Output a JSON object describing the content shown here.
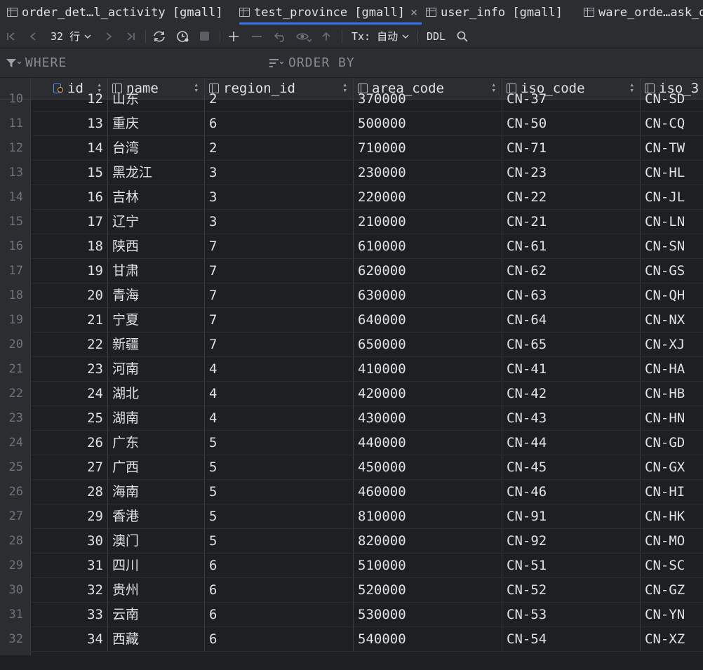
{
  "tabs": [
    {
      "label": "order_det…l_activity [gmall]",
      "active": false
    },
    {
      "label": "test_province [gmall]",
      "active": true
    },
    {
      "label": "user_info [gmall]",
      "active": false
    },
    {
      "label": "ware_orde…ask_d",
      "active": false
    }
  ],
  "toolbar": {
    "row_count_label": "32 行",
    "tx_label": "Tx: 自动",
    "ddl_label": "DDL"
  },
  "filter": {
    "where_label": "WHERE",
    "order_by_label": "ORDER BY"
  },
  "columns": [
    "id",
    "name",
    "region_id",
    "area_code",
    "iso_code",
    "iso_3"
  ],
  "rows": [
    {
      "n": "10",
      "id": "12",
      "name": "山东",
      "region_id": "2",
      "area_code": "370000",
      "iso_code": "CN-37",
      "iso_3": "CN-SD"
    },
    {
      "n": "11",
      "id": "13",
      "name": "重庆",
      "region_id": "6",
      "area_code": "500000",
      "iso_code": "CN-50",
      "iso_3": "CN-CQ"
    },
    {
      "n": "12",
      "id": "14",
      "name": "台湾",
      "region_id": "2",
      "area_code": "710000",
      "iso_code": "CN-71",
      "iso_3": "CN-TW"
    },
    {
      "n": "13",
      "id": "15",
      "name": "黑龙江",
      "region_id": "3",
      "area_code": "230000",
      "iso_code": "CN-23",
      "iso_3": "CN-HL"
    },
    {
      "n": "14",
      "id": "16",
      "name": "吉林",
      "region_id": "3",
      "area_code": "220000",
      "iso_code": "CN-22",
      "iso_3": "CN-JL"
    },
    {
      "n": "15",
      "id": "17",
      "name": "辽宁",
      "region_id": "3",
      "area_code": "210000",
      "iso_code": "CN-21",
      "iso_3": "CN-LN"
    },
    {
      "n": "16",
      "id": "18",
      "name": "陕西",
      "region_id": "7",
      "area_code": "610000",
      "iso_code": "CN-61",
      "iso_3": "CN-SN"
    },
    {
      "n": "17",
      "id": "19",
      "name": "甘肃",
      "region_id": "7",
      "area_code": "620000",
      "iso_code": "CN-62",
      "iso_3": "CN-GS"
    },
    {
      "n": "18",
      "id": "20",
      "name": "青海",
      "region_id": "7",
      "area_code": "630000",
      "iso_code": "CN-63",
      "iso_3": "CN-QH"
    },
    {
      "n": "19",
      "id": "21",
      "name": "宁夏",
      "region_id": "7",
      "area_code": "640000",
      "iso_code": "CN-64",
      "iso_3": "CN-NX"
    },
    {
      "n": "20",
      "id": "22",
      "name": "新疆",
      "region_id": "7",
      "area_code": "650000",
      "iso_code": "CN-65",
      "iso_3": "CN-XJ"
    },
    {
      "n": "21",
      "id": "23",
      "name": "河南",
      "region_id": "4",
      "area_code": "410000",
      "iso_code": "CN-41",
      "iso_3": "CN-HA"
    },
    {
      "n": "22",
      "id": "24",
      "name": "湖北",
      "region_id": "4",
      "area_code": "420000",
      "iso_code": "CN-42",
      "iso_3": "CN-HB"
    },
    {
      "n": "23",
      "id": "25",
      "name": "湖南",
      "region_id": "4",
      "area_code": "430000",
      "iso_code": "CN-43",
      "iso_3": "CN-HN"
    },
    {
      "n": "24",
      "id": "26",
      "name": "广东",
      "region_id": "5",
      "area_code": "440000",
      "iso_code": "CN-44",
      "iso_3": "CN-GD"
    },
    {
      "n": "25",
      "id": "27",
      "name": "广西",
      "region_id": "5",
      "area_code": "450000",
      "iso_code": "CN-45",
      "iso_3": "CN-GX"
    },
    {
      "n": "26",
      "id": "28",
      "name": "海南",
      "region_id": "5",
      "area_code": "460000",
      "iso_code": "CN-46",
      "iso_3": "CN-HI"
    },
    {
      "n": "27",
      "id": "29",
      "name": "香港",
      "region_id": "5",
      "area_code": "810000",
      "iso_code": "CN-91",
      "iso_3": "CN-HK"
    },
    {
      "n": "28",
      "id": "30",
      "name": "澳门",
      "region_id": "5",
      "area_code": "820000",
      "iso_code": "CN-92",
      "iso_3": "CN-MO"
    },
    {
      "n": "29",
      "id": "31",
      "name": "四川",
      "region_id": "6",
      "area_code": "510000",
      "iso_code": "CN-51",
      "iso_3": "CN-SC"
    },
    {
      "n": "30",
      "id": "32",
      "name": "贵州",
      "region_id": "6",
      "area_code": "520000",
      "iso_code": "CN-52",
      "iso_3": "CN-GZ"
    },
    {
      "n": "31",
      "id": "33",
      "name": "云南",
      "region_id": "6",
      "area_code": "530000",
      "iso_code": "CN-53",
      "iso_3": "CN-YN"
    },
    {
      "n": "32",
      "id": "34",
      "name": "西藏",
      "region_id": "6",
      "area_code": "540000",
      "iso_code": "CN-54",
      "iso_3": "CN-XZ"
    }
  ]
}
